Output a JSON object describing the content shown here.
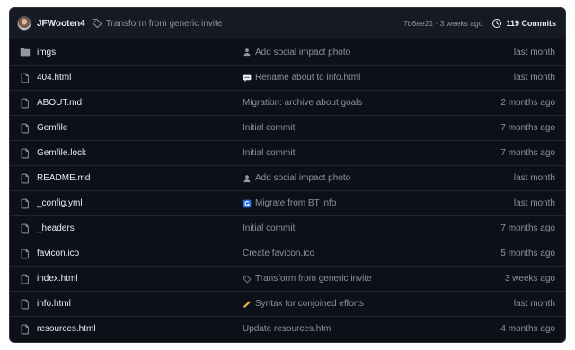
{
  "header": {
    "author": "JFWooten4",
    "commit_message": "Transform from generic invite",
    "sha_and_time": "7b6ee21 · 3 weeks ago",
    "commits_label": "119 Commits",
    "icons": [
      "avatar",
      "tag-icon",
      "history-icon"
    ]
  },
  "files": [
    {
      "name": "imgs",
      "type": "folder",
      "message": "Add social impact photo",
      "msg_icon": "person-emoji",
      "time": "last month"
    },
    {
      "name": "404.html",
      "type": "file",
      "message": "Rename about to info.html",
      "msg_icon": "speech-bubble-emoji",
      "time": "last month"
    },
    {
      "name": "ABOUT.md",
      "type": "file",
      "message": "Migration: archive about goals",
      "msg_icon": "",
      "time": "2 months ago"
    },
    {
      "name": "Gemfile",
      "type": "file",
      "message": "Initial commit",
      "msg_icon": "",
      "time": "7 months ago"
    },
    {
      "name": "Gemfile.lock",
      "type": "file",
      "message": "Initial commit",
      "msg_icon": "",
      "time": "7 months ago"
    },
    {
      "name": "README.md",
      "type": "file",
      "message": "Add social impact photo",
      "msg_icon": "person-emoji",
      "time": "last month"
    },
    {
      "name": "_config.yml",
      "type": "file",
      "message": "Migrate from BT info",
      "msg_icon": "blue-g-emoji",
      "time": "last month"
    },
    {
      "name": "_headers",
      "type": "file",
      "message": "Initial commit",
      "msg_icon": "",
      "time": "7 months ago"
    },
    {
      "name": "favicon.ico",
      "type": "file",
      "message": "Create favicon.ico",
      "msg_icon": "",
      "time": "5 months ago"
    },
    {
      "name": "index.html",
      "type": "file",
      "message": "Transform from generic invite",
      "msg_icon": "tag-icon",
      "time": "3 weeks ago"
    },
    {
      "name": "info.html",
      "type": "file",
      "message": "Syntax for conjoined efforts",
      "msg_icon": "pencil-emoji",
      "time": "last month"
    },
    {
      "name": "resources.html",
      "type": "file",
      "message": "Update resources.html",
      "msg_icon": "",
      "time": "4 months ago"
    }
  ],
  "colors": {
    "background": "#0d1117",
    "header_bg": "#161b22",
    "border": "#30363d",
    "text": "#e6edf3",
    "muted": "#8b949e",
    "folder": "#9198a1"
  }
}
